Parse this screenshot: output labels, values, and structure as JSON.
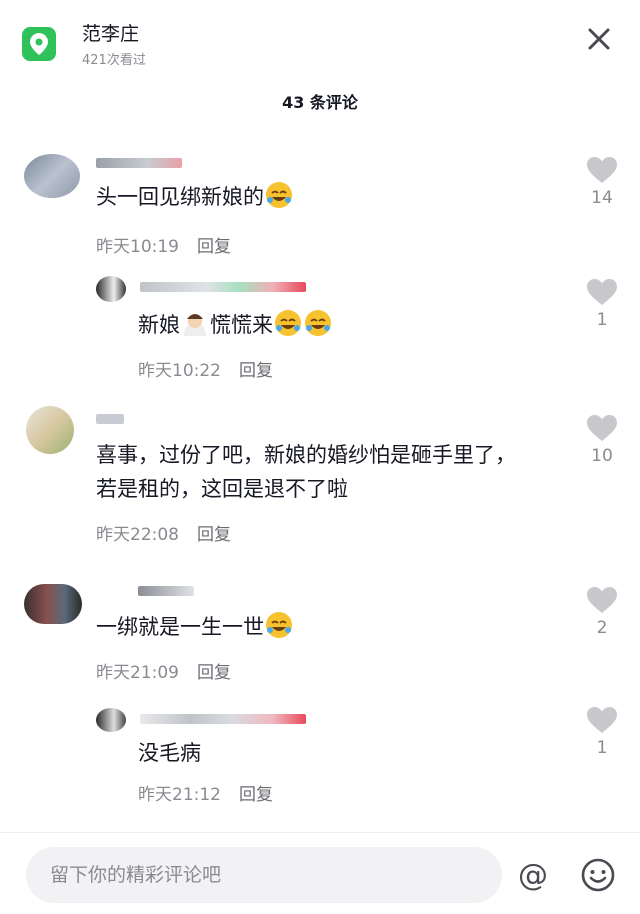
{
  "header": {
    "location_name": "范李庄",
    "views": "421次看过"
  },
  "comment_count": "43 条评论",
  "comments": [
    {
      "text": "头一回见绑新娘的",
      "emoji": "rofl",
      "time": "昨天10:19",
      "reply": "回复",
      "likes": "14"
    },
    {
      "text": "新娘",
      "text2": "慌慌来",
      "emoji": "rofl",
      "time": "昨天10:22",
      "reply": "回复",
      "likes": "1"
    },
    {
      "text": "喜事，过份了吧，新娘的婚纱怕是砸手里了，",
      "text2": "若是租的，这回是退不了啦",
      "time": "昨天22:08",
      "reply": "回复",
      "likes": "10"
    },
    {
      "text": "一绑就是一生一世",
      "emoji": "rofl",
      "time": "昨天21:09",
      "reply": "回复",
      "likes": "2"
    },
    {
      "text": "没毛病",
      "time": "昨天21:12",
      "reply": "回复",
      "likes": "1"
    }
  ],
  "input": {
    "placeholder": "留下你的精彩评论吧"
  },
  "icons": [
    "location-pin-icon",
    "close-icon",
    "heart-icon",
    "at-icon",
    "smile-icon",
    "rofl-emoji",
    "bride-emoji"
  ],
  "colors": {
    "location_green": "#2fc25b",
    "text": "#161823",
    "meta": "#8a8b91",
    "heart": "#c7c7cc"
  }
}
